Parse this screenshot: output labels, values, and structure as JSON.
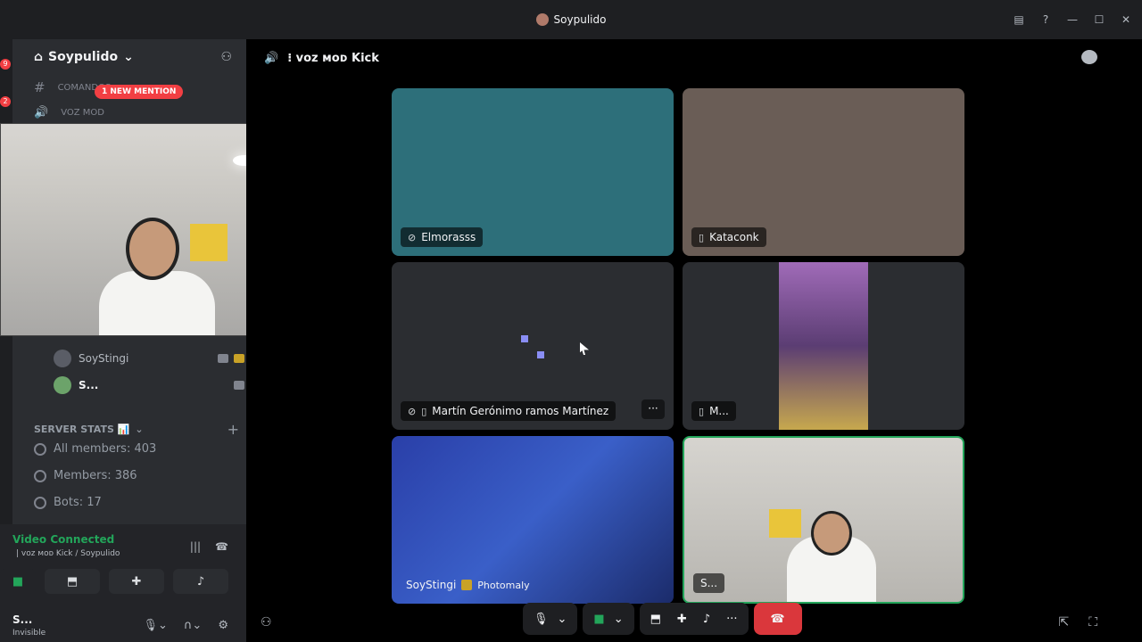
{
  "window": {
    "title": "Soypulido",
    "controls": [
      "inbox-icon",
      "help-icon",
      "minimize-icon",
      "maximize-icon",
      "close-icon"
    ]
  },
  "guild_rail": {
    "badges": [
      "9",
      "2"
    ]
  },
  "sidebar": {
    "server_name": "Soypulido",
    "channels": [
      {
        "name": "COMANDOS",
        "icon": "hash-icon"
      },
      {
        "name": "VOZ MOD",
        "icon": "voice-icon"
      }
    ],
    "mention_pill": "1 NEW MENTION",
    "members": [
      {
        "name": "SoyStingi"
      },
      {
        "name": "S..."
      }
    ],
    "category": "SERVER STATS 📊",
    "stats": [
      {
        "label": "All members: 403"
      },
      {
        "label": "Members: 386"
      },
      {
        "label": "Bots: 17"
      }
    ]
  },
  "voice_panel": {
    "status": "Video Connected",
    "location": "| voz мoᴅ Kick / Soypulido"
  },
  "user_panel": {
    "name": "S...",
    "status": "Invisible"
  },
  "main": {
    "channel_title": "⁝ voz мoᴅ Kick",
    "tiles": [
      {
        "name": "Elmorasss",
        "icon": "muted-mic-icon",
        "color": "#2d6f7a"
      },
      {
        "name": "Kataconk",
        "icon": "mobile-icon",
        "color": "#6a5d56"
      },
      {
        "name": "Martín Gerónimo ramos Martínez",
        "icon": "muted-mic-icon",
        "color": "#2b2d31"
      },
      {
        "name": "M...",
        "icon": "mobile-icon",
        "color": "#5b3d73"
      },
      {
        "name": "SoyStingi",
        "extra": "Photomaly",
        "color": "#2a3fa8"
      },
      {
        "name": "S...",
        "color": "#b7b5b0"
      }
    ],
    "more_label": "···"
  },
  "call_controls": {
    "buttons": [
      "mic-icon",
      "camera-icon",
      "screen-share-icon",
      "activities-icon",
      "soundboard-icon",
      "more-icon",
      "end-call-icon"
    ]
  }
}
